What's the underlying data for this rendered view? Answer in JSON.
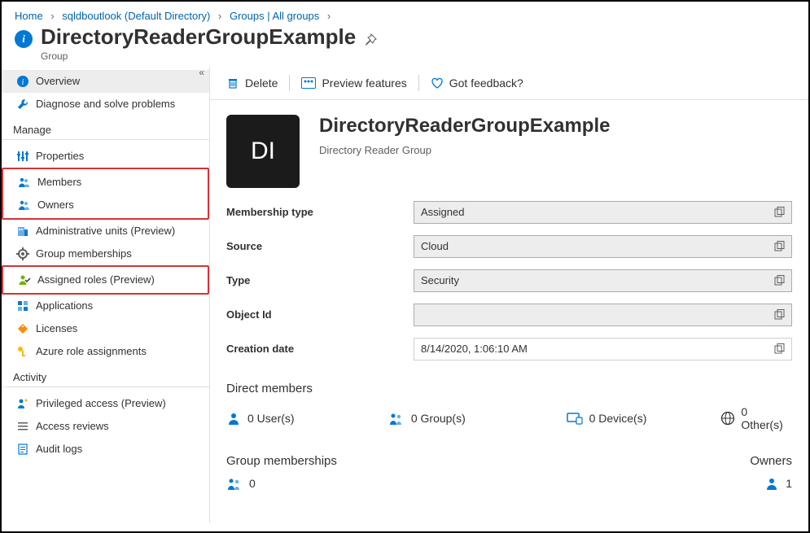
{
  "breadcrumb": {
    "home": "Home",
    "directory": "sqldboutlook (Default Directory)",
    "groups": "Groups | All groups"
  },
  "header": {
    "title": "DirectoryReaderGroupExample",
    "subtitle": "Group"
  },
  "toolbar": {
    "delete": "Delete",
    "preview": "Preview features",
    "feedback": "Got feedback?"
  },
  "sidebar": {
    "overview": "Overview",
    "diagnose": "Diagnose and solve problems",
    "section_manage": "Manage",
    "properties": "Properties",
    "members": "Members",
    "owners": "Owners",
    "admin_units": "Administrative units (Preview)",
    "group_memberships": "Group memberships",
    "assigned_roles": "Assigned roles (Preview)",
    "applications": "Applications",
    "licenses": "Licenses",
    "azure_role": "Azure role assignments",
    "section_activity": "Activity",
    "privileged": "Privileged access (Preview)",
    "access_reviews": "Access reviews",
    "audit_logs": "Audit logs"
  },
  "hero": {
    "initials": "DI",
    "name": "DirectoryReaderGroupExample",
    "desc": "Directory Reader Group"
  },
  "props": {
    "membership_label": "Membership type",
    "membership_value": "Assigned",
    "source_label": "Source",
    "source_value": "Cloud",
    "type_label": "Type",
    "type_value": "Security",
    "objectid_label": "Object Id",
    "objectid_value": "",
    "creation_label": "Creation date",
    "creation_value": "8/14/2020, 1:06:10 AM"
  },
  "direct_members": {
    "title": "Direct members",
    "users": "0 User(s)",
    "groups": "0 Group(s)",
    "devices": "0 Device(s)",
    "others": "0 Other(s)"
  },
  "group_memberships_section": {
    "title": "Group memberships",
    "count": "0",
    "owners_label": "Owners",
    "owners_count": "1"
  }
}
